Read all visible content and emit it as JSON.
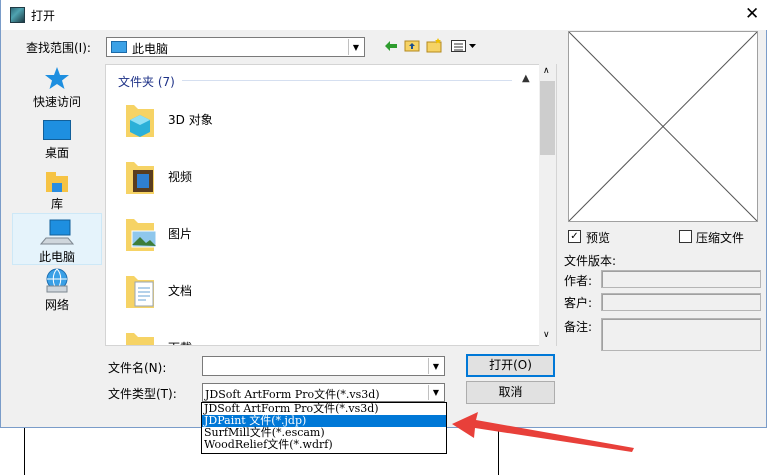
{
  "window": {
    "title": "打开"
  },
  "lookin": {
    "label": "查找范围(I):",
    "value": "此电脑"
  },
  "places": [
    {
      "label": "快速访问",
      "icon": "star-icon"
    },
    {
      "label": "桌面",
      "icon": "desktop-icon"
    },
    {
      "label": "库",
      "icon": "library-icon"
    },
    {
      "label": "此电脑",
      "icon": "computer-icon"
    },
    {
      "label": "网络",
      "icon": "network-icon"
    }
  ],
  "filelist": {
    "group_header": "文件夹 (7)",
    "items": [
      {
        "name": "3D 对象",
        "icon": "3d-objects-folder-icon"
      },
      {
        "name": "视频",
        "icon": "videos-folder-icon"
      },
      {
        "name": "图片",
        "icon": "pictures-folder-icon"
      },
      {
        "name": "文档",
        "icon": "documents-folder-icon"
      },
      {
        "name": "下载",
        "icon": "downloads-folder-icon"
      }
    ]
  },
  "filename": {
    "label": "文件名(N):",
    "value": ""
  },
  "filetype": {
    "label": "文件类型(T):",
    "value": "JDSoft ArtForm Pro文件(*.vs3d)",
    "options": [
      "JDSoft ArtForm Pro文件(*.vs3d)",
      "JDPaint 文件(*.jdp)",
      "SurfMill文件(*.escam)",
      "WoodRelief文件(*.wdrf)"
    ],
    "highlighted_index": 1
  },
  "buttons": {
    "open": "打开(O)",
    "cancel": "取消"
  },
  "options": {
    "preview_label": "预览",
    "preview_checked": true,
    "compress_label": "压缩文件",
    "compress_checked": false
  },
  "info": {
    "version_label": "文件版本:",
    "author_label": "作者:",
    "client_label": "客户:",
    "remark_label": "备注:"
  },
  "colors": {
    "accent": "#0078d7",
    "annotation_arrow": "#e8403a"
  }
}
